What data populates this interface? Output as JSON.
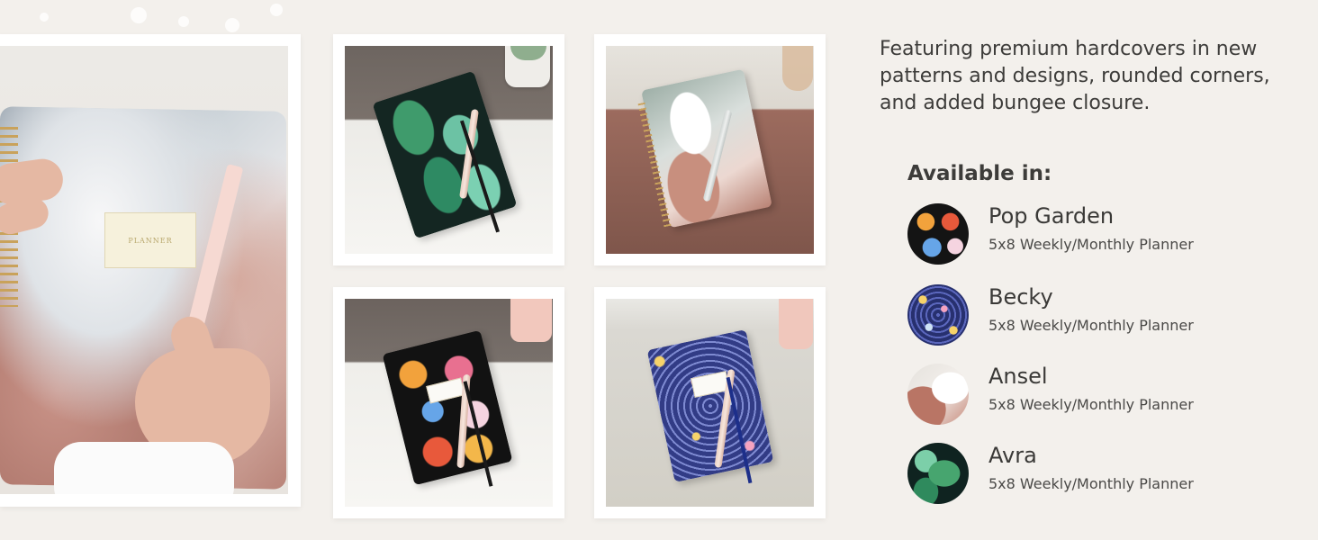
{
  "headline": "Featuring premium hardcovers in new patterns and designs, rounded corners, and added bungee closure.",
  "available_title": "Available in:",
  "variants": [
    {
      "name": "Pop Garden",
      "description": "5x8 Weekly/Monthly Planner",
      "swatch": "pop-garden-floral-swatch"
    },
    {
      "name": "Becky",
      "description": "5x8 Weekly/Monthly Planner",
      "swatch": "becky-ditsy-floral-swatch"
    },
    {
      "name": "Ansel",
      "description": "5x8 Weekly/Monthly Planner",
      "swatch": "ansel-brushstroke-swatch"
    },
    {
      "name": "Avra",
      "description": "5x8 Weekly/Monthly Planner",
      "swatch": "avra-palm-leaf-swatch"
    }
  ],
  "colors": {
    "background": "#f3f0ec",
    "text": "#3d3c3a",
    "frame": "#ffffff"
  }
}
